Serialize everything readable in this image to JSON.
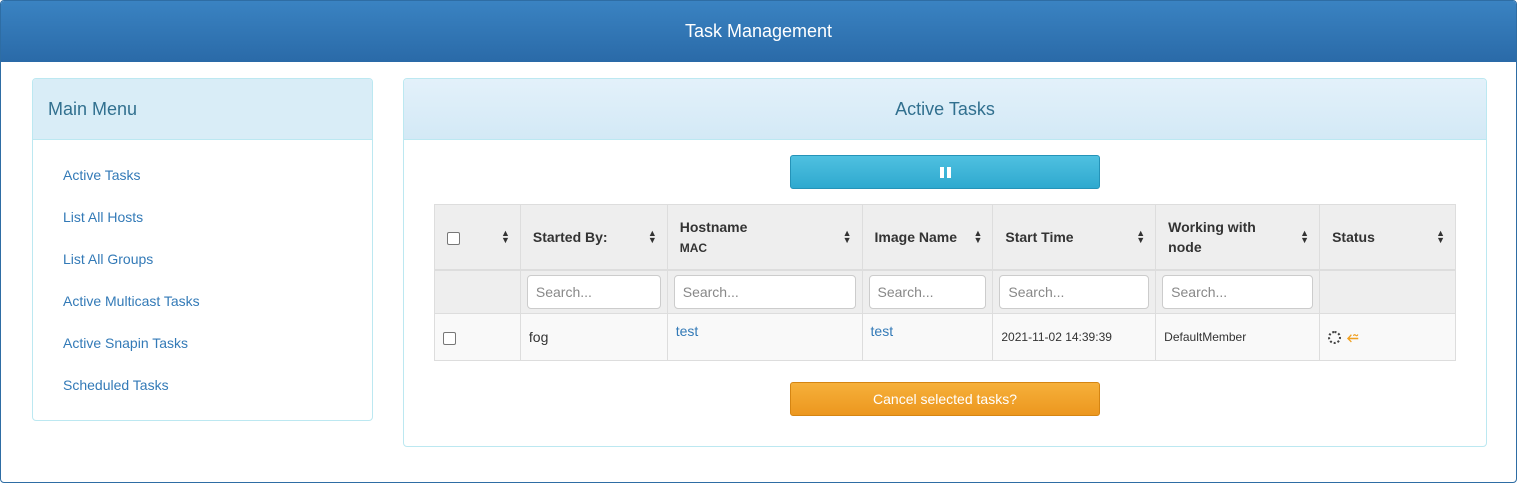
{
  "header": {
    "title": "Task Management"
  },
  "sidebar": {
    "title": "Main Menu",
    "items": [
      {
        "label": "Active Tasks"
      },
      {
        "label": "List All Hosts"
      },
      {
        "label": "List All Groups"
      },
      {
        "label": "Active Multicast Tasks"
      },
      {
        "label": "Active Snapin Tasks"
      },
      {
        "label": "Scheduled Tasks"
      }
    ]
  },
  "main": {
    "title": "Active Tasks",
    "pause_icon": "pause-icon",
    "table": {
      "columns": [
        {
          "label": ""
        },
        {
          "label": "Started By:"
        },
        {
          "label": "Hostname",
          "sub": "MAC"
        },
        {
          "label": "Image Name"
        },
        {
          "label": "Start Time"
        },
        {
          "label": "Working with node"
        },
        {
          "label": "Status"
        }
      ],
      "search_placeholder": "Search...",
      "rows": [
        {
          "started_by": "fog",
          "hostname": "test",
          "image_name": "test",
          "start_time": "2021-11-02 14:39:39",
          "node": "DefaultMember",
          "status_icons": [
            "spinner-icon",
            "upload-icon"
          ]
        }
      ]
    },
    "cancel_label": "Cancel selected tasks?"
  },
  "colors": {
    "topbar": "#2e6da4",
    "panel_heading": "#d9edf7",
    "info_button": "#31b0d5",
    "warning_button": "#f0ad4e",
    "link": "#337ab7"
  }
}
